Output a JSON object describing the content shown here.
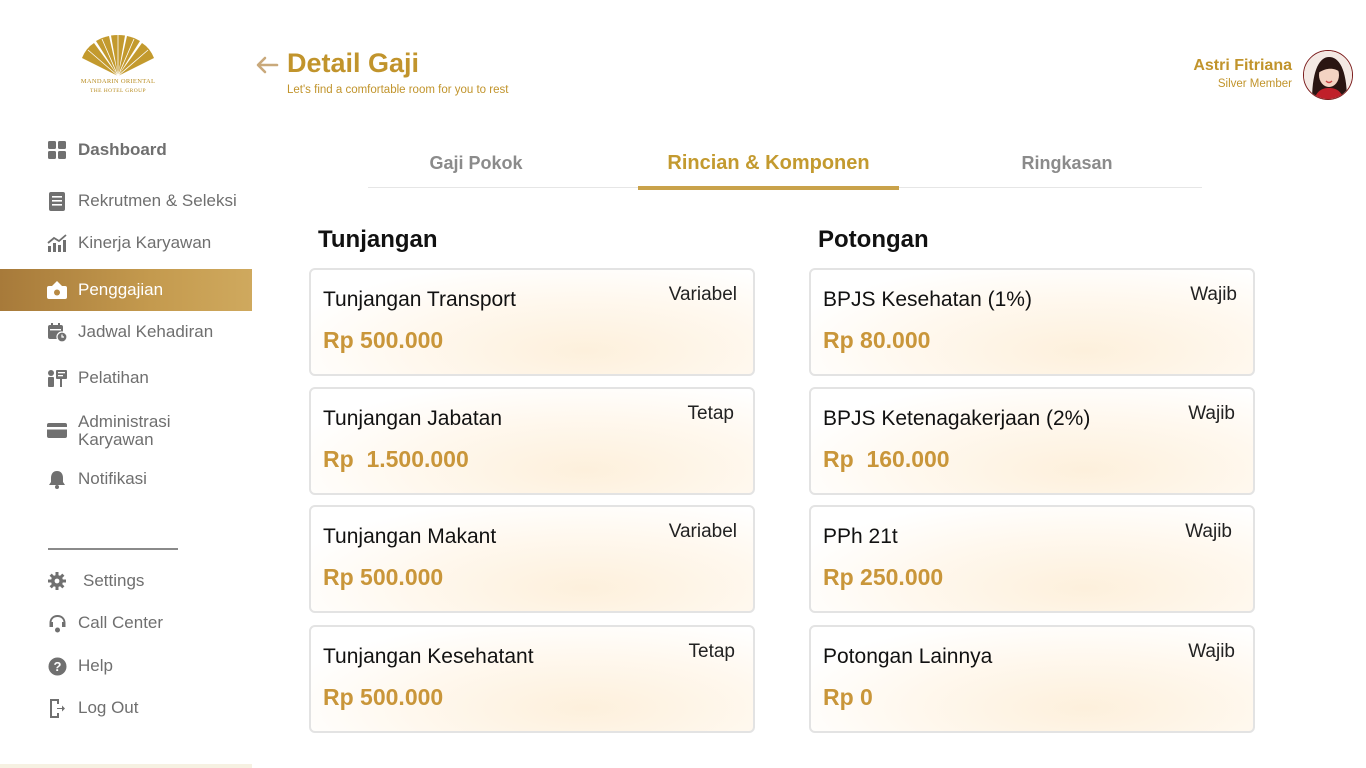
{
  "brand": {
    "line1": "MANDARIN ORIENTAL",
    "line2": "THE HOTEL GROUP",
    "color": "#C1942C"
  },
  "header": {
    "title": "Detail Gaji",
    "subtitle": "Let's find a comfortable room for you to rest",
    "back_icon": "arrow-left-icon"
  },
  "user": {
    "name": "Astri Fitriana",
    "tier": "Silver Member"
  },
  "sidebar": {
    "items": [
      {
        "label": "Dashboard",
        "icon": "grid-icon",
        "active": false
      },
      {
        "label": "Rekrutmen & Seleksi",
        "icon": "document-list-icon",
        "active": false
      },
      {
        "label": "Kinerja Karyawan",
        "icon": "chart-up-icon",
        "active": false
      },
      {
        "label": "Penggajian",
        "icon": "payroll-icon",
        "active": true
      },
      {
        "label": "Jadwal Kehadiran",
        "icon": "calendar-clock-icon",
        "active": false
      },
      {
        "label": "Pelatihan",
        "icon": "training-icon",
        "active": false
      },
      {
        "label": "Administrasi Karyawan",
        "icon": "card-icon",
        "active": false
      },
      {
        "label": "Notifikasi",
        "icon": "bell-icon",
        "active": false
      }
    ],
    "bottom_items": [
      {
        "label": "Settings",
        "icon": "gear-icon"
      },
      {
        "label": "Call Center",
        "icon": "headset-icon"
      },
      {
        "label": "Help",
        "icon": "help-circle-icon"
      },
      {
        "label": "Log Out",
        "icon": "logout-icon"
      }
    ]
  },
  "tabs": [
    {
      "label": "Gaji Pokok",
      "active": false
    },
    {
      "label": "Rincian & Komponen",
      "active": true
    },
    {
      "label": "Ringkasan",
      "active": false
    }
  ],
  "tunjangan": {
    "title": "Tunjangan",
    "items": [
      {
        "name": "Tunjangan Transport",
        "tag": "Variabel",
        "amount": "Rp 500.000"
      },
      {
        "name": "Tunjangan Jabatan",
        "tag": "Tetap",
        "amount": "Rp  1.500.000"
      },
      {
        "name": "Tunjangan Makant",
        "tag": "Variabel",
        "amount": "Rp 500.000"
      },
      {
        "name": "Tunjangan Kesehatant",
        "tag": "Tetap",
        "amount": "Rp 500.000"
      }
    ]
  },
  "potongan": {
    "title": "Potongan",
    "items": [
      {
        "name": "BPJS Kesehatan (1%)",
        "tag": "Wajib",
        "amount": "Rp 80.000"
      },
      {
        "name": "BPJS Ketenagakerjaan (2%)",
        "tag": "Wajib",
        "amount": "Rp  160.000"
      },
      {
        "name": "PPh 21t",
        "tag": "Wajib",
        "amount": "Rp 250.000"
      },
      {
        "name": "Potongan Lainnya",
        "tag": "Wajib",
        "amount": "Rp 0"
      }
    ]
  },
  "colors": {
    "accent": "#C1942C",
    "amount": "#C9963A",
    "active_nav_start": "#A77A3A",
    "active_nav_end": "#CFA95E",
    "muted_text": "#6F6F6F"
  }
}
